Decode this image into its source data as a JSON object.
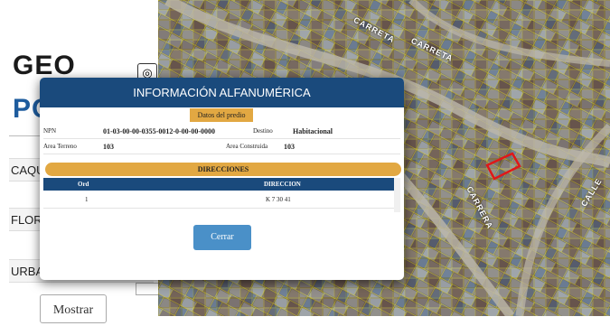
{
  "sidebar": {
    "logo_line1": "GEO",
    "logo_line2": "PO",
    "rows": [
      "CAQU",
      "FLORE",
      "URBA"
    ],
    "show_button": "Mostrar"
  },
  "map": {
    "streets": [
      "CARRETA",
      "CARRETA",
      "CARRERA",
      "CALLE"
    ]
  },
  "modal": {
    "title": "INFORMACIÓN ALFANUMÉRICA",
    "tab_label": "Datos del predio",
    "npn_label": "NPN",
    "npn_value": "01-03-00-00-0355-0012-0-00-00-0000",
    "destino_label": "Destino",
    "destino_value": "Habitacional",
    "area_terreno_label": "Area Terreno",
    "area_terreno_value": "103",
    "area_construida_label": "Area Construida",
    "area_construida_value": "103",
    "direcciones_title": "DIRECCIONES",
    "col_ord": "Ord",
    "col_direccion": "DIRECCION",
    "rows": [
      {
        "ord": "1",
        "direccion": "K 7 30 41"
      }
    ],
    "close_button": "Cerrar"
  },
  "colors": {
    "header_blue": "#1a4a7c",
    "accent_gold": "#e2a842",
    "button_blue": "#4a90c8",
    "selection_red": "#e01818"
  }
}
